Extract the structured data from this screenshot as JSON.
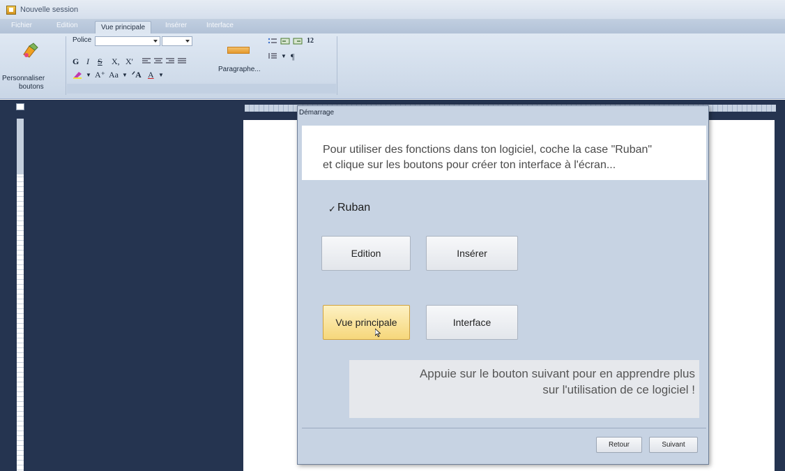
{
  "window": {
    "title": "Nouvelle session"
  },
  "ribbon": {
    "tabs": [
      {
        "label": "Fichier",
        "active": false
      },
      {
        "label": "Edition",
        "active": false
      },
      {
        "label": "Vue principale",
        "active": true
      },
      {
        "label": "Insérer",
        "active": false
      },
      {
        "label": "Interface",
        "active": false
      }
    ],
    "customize_line1": "Personnaliser",
    "customize_line2": "boutons",
    "font_label": "Police",
    "format_buttons": [
      "G",
      "I",
      "S",
      "X,",
      "X'"
    ],
    "case_label": "Aa",
    "paragraph_label": "Paragraphe...",
    "pilcrow": "¶",
    "number_label": "12"
  },
  "dialog": {
    "title": "Démarrage",
    "intro_line1": "Pour utiliser des fonctions dans ton logiciel, coche la case \"Ruban\"",
    "intro_line2": "et clique sur les boutons pour créer ton interface à l'écran...",
    "checkbox_label": "Ruban",
    "checkbox_checked": true,
    "buttons": {
      "edition": "Edition",
      "inserer": "Insérer",
      "vue_principale": "Vue principale",
      "interface": "Interface"
    },
    "selected_button": "vue_principale",
    "info_line1": "Appuie sur le bouton suivant pour en apprendre plus",
    "info_line2": "sur l'utilisation de ce logiciel !",
    "back_label": "Retour",
    "next_label": "Suivant"
  },
  "colors": {
    "workspace": "#253450",
    "ribbon": "#d3dfec",
    "dialog": "#c7d3e3",
    "selected_button": "#f6d77b"
  }
}
